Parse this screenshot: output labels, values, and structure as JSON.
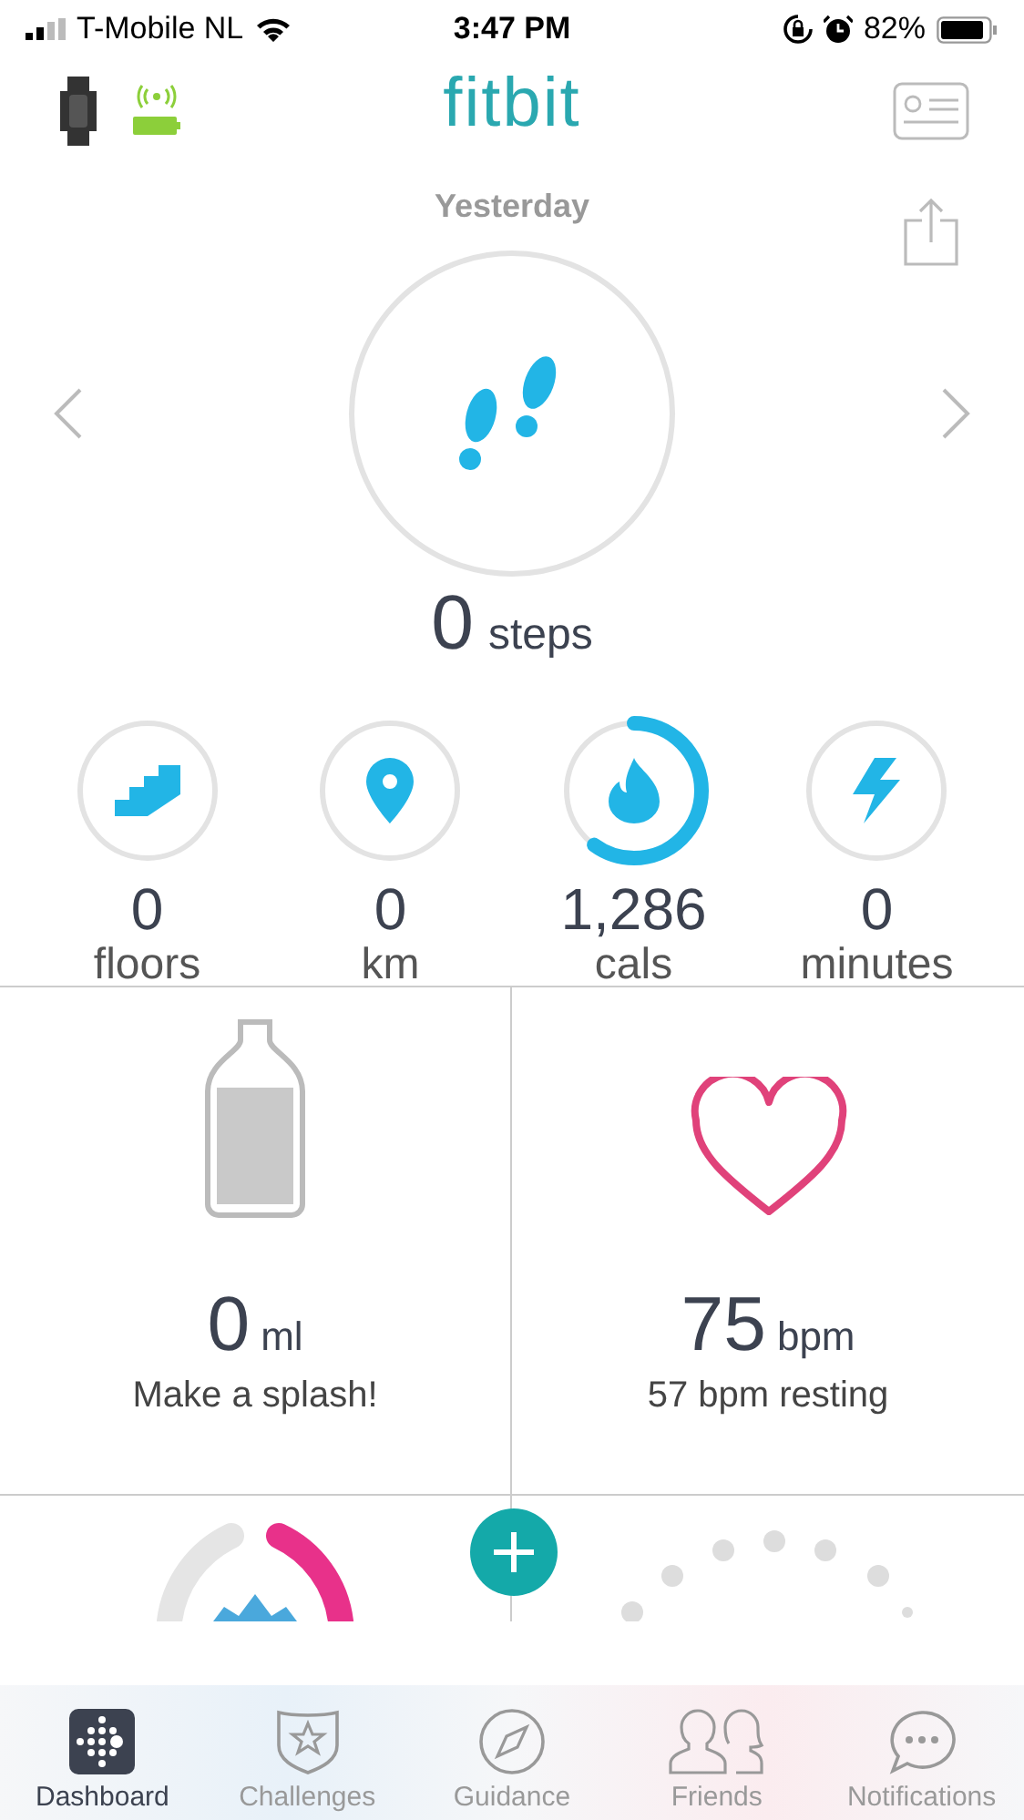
{
  "status_bar": {
    "carrier": "T-Mobile NL",
    "time": "3:47 PM",
    "battery": "82%"
  },
  "header": {
    "logo": "fitbit"
  },
  "day": "Yesterday",
  "steps": {
    "value": "0",
    "unit": "steps"
  },
  "stats": [
    {
      "kind": "floors",
      "value": "0",
      "label": "floors"
    },
    {
      "kind": "distance",
      "value": "0",
      "label": "km"
    },
    {
      "kind": "calories",
      "value": "1,286",
      "label": "cals"
    },
    {
      "kind": "minutes",
      "value": "0",
      "label": "minutes"
    }
  ],
  "tiles": [
    {
      "kind": "water",
      "value": "0",
      "unit": "ml",
      "caption": "Make a splash!"
    },
    {
      "kind": "heart",
      "value": "75",
      "unit": "bpm",
      "caption": "57 bpm resting"
    }
  ],
  "tabs": [
    {
      "label": "Dashboard",
      "selected": true
    },
    {
      "label": "Challenges",
      "selected": false
    },
    {
      "label": "Guidance",
      "selected": false
    },
    {
      "label": "Friends",
      "selected": false
    },
    {
      "label": "Notifications",
      "selected": false
    }
  ]
}
